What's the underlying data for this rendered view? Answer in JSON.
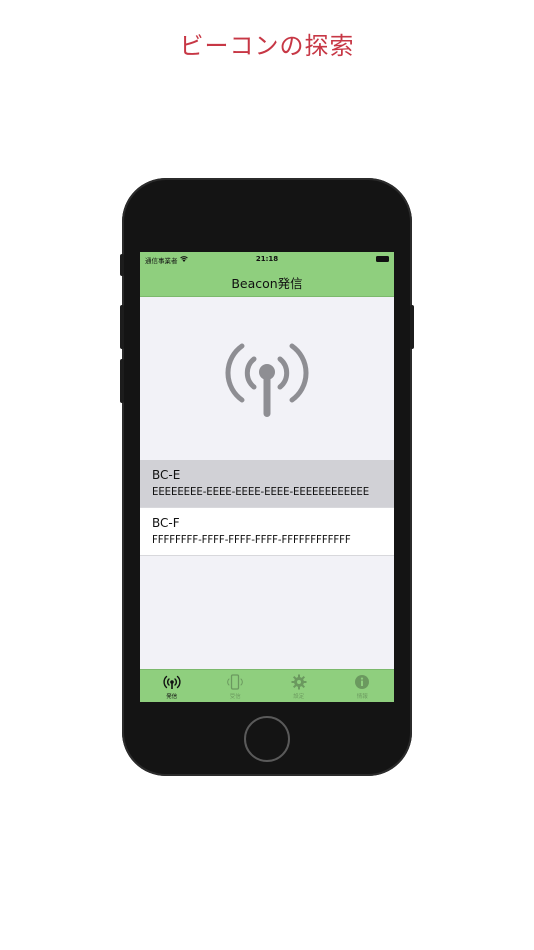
{
  "promo": {
    "title": "ビーコンの探索"
  },
  "status_bar": {
    "carrier": "通信事業者",
    "time": "21:18"
  },
  "nav": {
    "title": "Beacon発信"
  },
  "hero": {
    "icon": "antenna-broadcast-icon",
    "color": "#8e8e93"
  },
  "beacons": [
    {
      "name": "BC-E",
      "uuid": "EEEEEEEE-EEEE-EEEE-EEEE-EEEEEEEEEEEE",
      "selected": true
    },
    {
      "name": "BC-F",
      "uuid": "FFFFFFFF-FFFF-FFFF-FFFF-FFFFFFFFFFFF",
      "selected": false
    }
  ],
  "tab_bar": {
    "tabs": [
      {
        "label": "発信",
        "icon": "antenna-icon",
        "active": true
      },
      {
        "label": "受信",
        "icon": "phone-signal-icon",
        "active": false
      },
      {
        "label": "設定",
        "icon": "gear-icon",
        "active": false
      },
      {
        "label": "情報",
        "icon": "info-icon",
        "active": false
      }
    ]
  },
  "colors": {
    "accent_green": "#8fcf7e",
    "promo_red": "#c73745",
    "selected_row": "#d1d1d6"
  }
}
